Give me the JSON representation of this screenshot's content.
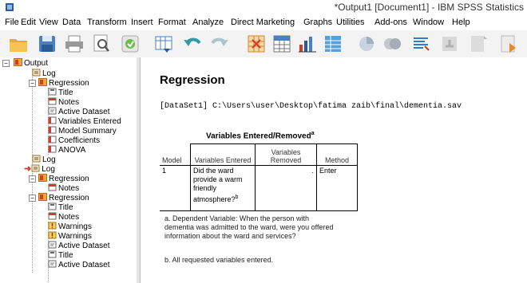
{
  "window": {
    "title": "*Output1 [Document1] - IBM SPSS Statistics"
  },
  "menu": [
    {
      "label": "File"
    },
    {
      "label": "Edit"
    },
    {
      "label": "View"
    },
    {
      "label": "Data"
    },
    {
      "label": "Transform"
    },
    {
      "label": "Insert"
    },
    {
      "label": "Format"
    },
    {
      "label": "Analyze"
    },
    {
      "label": "Direct Marketing"
    },
    {
      "label": "Graphs"
    },
    {
      "label": "Utilities"
    },
    {
      "label": "Add-ons"
    },
    {
      "label": "Window"
    },
    {
      "label": "Help"
    }
  ],
  "toolbar": {
    "icons": [
      "open-icon",
      "save-icon",
      "print-icon",
      "print-preview-icon",
      "export-icon",
      "goto-data-icon",
      "undo-icon",
      "redo-icon",
      "goto-case-icon",
      "goto-variable-icon",
      "chart-builder-icon",
      "insert-table-icon",
      "pie-icon",
      "scatter-icon",
      "designate-window-icon",
      "promote-icon",
      "demote-icon",
      "insert-text-icon"
    ]
  },
  "tree": {
    "output": "Output",
    "log1": "Log",
    "regression1": "Regression",
    "title1": "Title",
    "notes1": "Notes",
    "active_dataset1": "Active Dataset",
    "variables_entered": "Variables Entered",
    "model_summary": "Model Summary",
    "coefficients": "Coefficients",
    "anova": "ANOVA",
    "log2": "Log",
    "log3": "Log",
    "regression2": "Regression",
    "notes2": "Notes",
    "regression3": "Regression",
    "title2": "Title",
    "notes3": "Notes",
    "warnings1": "Warnings",
    "warnings2": "Warnings",
    "active_dataset2": "Active Dataset",
    "title3": "Title",
    "active_dataset3": "Active Dataset"
  },
  "output": {
    "heading": "Regression",
    "dataset_line": "[DataSet1] C:\\Users\\user\\Desktop\\fatima zaib\\final\\dementia.sav",
    "table_title": "Variables Entered/Removed",
    "table_title_sup": "a",
    "columns": {
      "model": "Model",
      "entered": "Variables Entered",
      "removed": "Variables Removed",
      "method": "Method"
    },
    "row": {
      "model": "1",
      "entered": "Did the ward provide a warm friendly atmosphere?",
      "entered_sup": "b",
      "removed": ".",
      "method": "Enter"
    },
    "footnote_a": "a. Dependent Variable: When the person with dementia was admitted to the ward, were you offered information about the ward and services?",
    "footnote_b": "b. All requested variables entered."
  }
}
